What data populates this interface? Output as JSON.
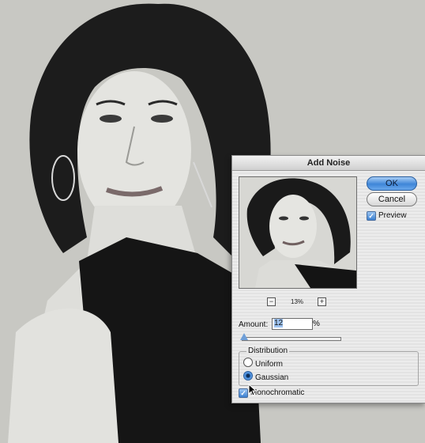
{
  "dialog": {
    "title": "Add Noise",
    "ok_label": "OK",
    "cancel_label": "Cancel",
    "preview_label": "Preview",
    "preview_checked": true,
    "zoom_out_label": "−",
    "zoom_in_label": "+",
    "zoom_percent": "13%",
    "amount_label": "Amount:",
    "amount_value": "12",
    "amount_unit": "%",
    "distribution_title": "Distribution",
    "uniform_label": "Uniform",
    "gaussian_label": "Gaussian",
    "selected_distribution": "Gaussian",
    "monochromatic_label": "Monochromatic",
    "monochromatic_checked": true
  },
  "colors": {
    "accent": "#3f86d8",
    "dialog_bg": "#e8e8e8",
    "photo_bg": "#c9c9c4"
  }
}
